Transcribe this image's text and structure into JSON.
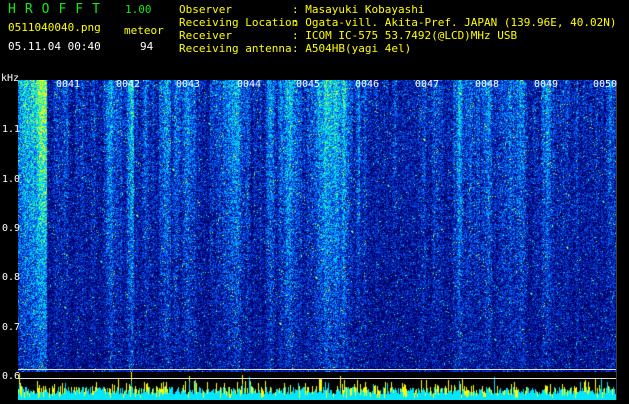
{
  "app": {
    "name": "HROFFT",
    "version": "1.00"
  },
  "file": {
    "name": "0511040040.png",
    "timestamp": "05.11.04 00:40"
  },
  "meteor": {
    "label": "meteor",
    "count": "94"
  },
  "station": [
    {
      "key": "Observer",
      "value": ": Masayuki Kobayashi"
    },
    {
      "key": "Receiving Location",
      "value": ": Ogata-vill. Akita-Pref. JAPAN (139.96E, 40.02N)"
    },
    {
      "key": "Receiver",
      "value": ": ICOM IC-575 53.7492(@LCD)MHz USB"
    },
    {
      "key": "Receiving antenna",
      "value": ": A504HB(yagi 4el)"
    }
  ],
  "spectrogram": {
    "freq_unit": "kHz",
    "freq_ticks": [
      "1.1",
      "1.0",
      "0.9",
      "0.8",
      "0.7",
      "0.6"
    ],
    "time_ticks": [
      "0041",
      "0042",
      "0043",
      "0044",
      "0045",
      "0046",
      "0047",
      "0048",
      "0049",
      "0050"
    ],
    "palette": [
      "#000066",
      "#001a99",
      "#0033cc",
      "#0066ff",
      "#00aaff",
      "#00e6e6",
      "#33ff99",
      "#ccff33",
      "#ffff00"
    ]
  }
}
